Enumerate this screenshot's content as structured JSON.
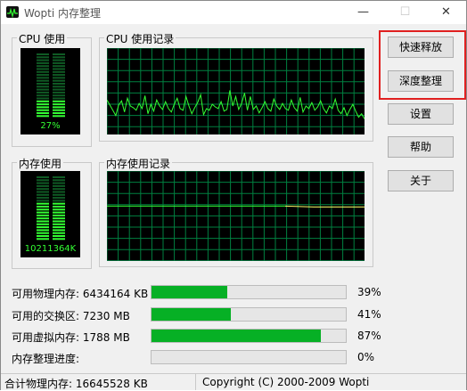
{
  "window": {
    "title": "Wopti 内存整理",
    "controls": {
      "minimize": "—",
      "maximize": "☐",
      "close": "✕"
    }
  },
  "cpu_usage": {
    "label": "CPU 使用",
    "percent_text": "27%",
    "level": 0.27
  },
  "cpu_history": {
    "label": "CPU 使用记录",
    "samples": [
      40,
      34,
      28,
      22,
      34,
      39,
      26,
      42,
      33,
      31,
      28,
      36,
      30,
      45,
      24,
      35,
      27,
      40,
      33,
      29,
      38,
      30,
      26,
      35,
      42,
      30,
      28,
      44,
      33,
      24,
      31,
      37,
      46,
      23,
      30,
      28,
      35,
      32,
      30,
      38,
      27,
      29,
      51,
      33,
      44,
      29,
      36,
      48,
      28,
      44,
      29,
      33,
      25,
      31,
      38,
      30,
      27,
      41,
      33,
      29,
      36,
      30,
      28,
      40,
      31,
      27,
      43,
      26,
      33,
      30,
      37,
      28,
      32,
      39,
      30,
      25,
      33,
      30,
      41,
      28,
      24,
      31,
      22,
      29,
      35,
      27,
      20,
      24,
      18
    ]
  },
  "memory_usage": {
    "label": "内存使用",
    "value_text": "10211364K",
    "level": 0.61
  },
  "memory_history": {
    "label": "内存使用记录",
    "level": 0.61
  },
  "buttons": {
    "quick_release": "快速释放",
    "deep_clean": "深度整理",
    "settings": "设置",
    "help": "帮助",
    "about": "关于"
  },
  "stats": [
    {
      "label": "可用物理内存: 6434164 KB",
      "percent": "39%",
      "fraction": 0.39
    },
    {
      "label": "可用的交换区: 7230 MB",
      "percent": "41%",
      "fraction": 0.41
    },
    {
      "label": "可用虚拟内存: 1788 MB",
      "percent": "87%",
      "fraction": 0.87
    },
    {
      "label": "内存整理进度:",
      "percent": "0%",
      "fraction": 0
    }
  ],
  "status": {
    "total_memory": "合计物理内存: 16645528 KB",
    "copyright": "Copyright (C) 2000-2009 Wopti"
  },
  "colors": {
    "meter_green": "#33ff33",
    "grid_green": "#008040",
    "graph_line": "#33ff33",
    "memory_line": "#ffff66",
    "progress_fill": "#06b025",
    "highlight": "#e02020"
  }
}
